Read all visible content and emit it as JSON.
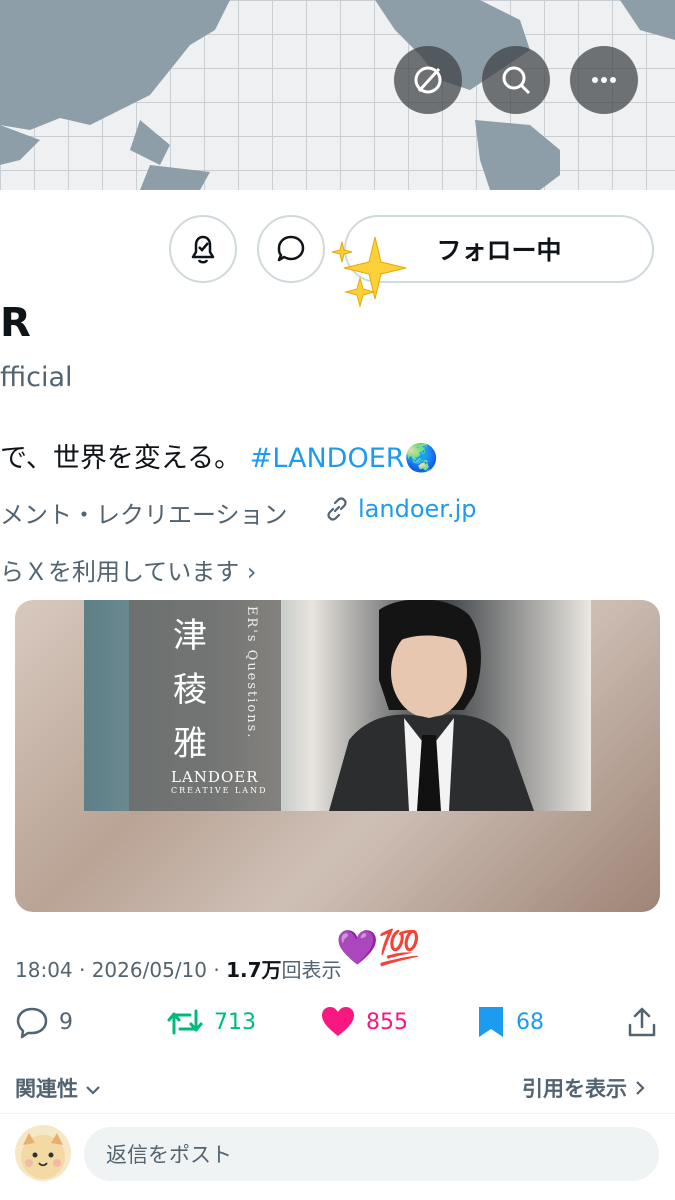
{
  "header": {
    "icons": [
      "hide-icon",
      "search-icon",
      "more-icon"
    ]
  },
  "actions": {
    "follow_label": "フォロー中"
  },
  "profile": {
    "name": "R",
    "handle": "fficial",
    "bio_text": "で、世界を変える。",
    "bio_hashtag": "#LANDOER",
    "bio_emoji": "🌏",
    "category": "メント・レクリエーション",
    "link": "landoer.jp",
    "joined": "らＸを利用しています",
    "joined_chevron": "›"
  },
  "media": {
    "title_chars": [
      "津",
      "稜",
      "雅"
    ],
    "vertical_text": "ER's Questions.",
    "logo": "LANDOER",
    "logo_sub": "CREATIVE LAND"
  },
  "tweet": {
    "time": "18:04 · 2026/05/10 · ",
    "views": "1.7万",
    "views_label": "回表示",
    "emoji": "💜💯"
  },
  "stats": {
    "replies": "9",
    "retweets": "713",
    "likes": "855",
    "bookmarks": "68"
  },
  "colors": {
    "retweet": "#00ba7c",
    "like": "#f91880",
    "bookmark": "#1d9bf0",
    "link": "#1d9bf0"
  },
  "replies_bar": {
    "sort_label": "関連性",
    "quotes_label": "引用を表示",
    "reply_placeholder": "返信をポスト"
  }
}
